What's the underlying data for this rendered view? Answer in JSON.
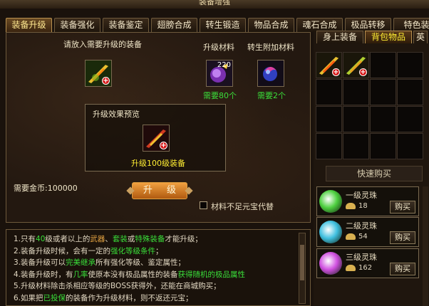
{
  "window": {
    "title": "装备增强"
  },
  "tabs": [
    "装备升级",
    "装备强化",
    "装备鉴定",
    "翅膀合成",
    "转生锻造",
    "物品合成",
    "魂石合成",
    "极品转移",
    "特色装"
  ],
  "main": {
    "equip_prompt": "请放入需要升级的装备",
    "material_title": "升级材料",
    "material_count": "220",
    "material_need": "需要80个",
    "extra_title": "转生附加材料",
    "extra_need": "需要2个",
    "preview_title": "升级效果预览",
    "preview_result": "升级100级装备",
    "gold_label": "需要金币:100000",
    "upgrade_button": "升 级",
    "ingot_checkbox": "材料不足元宝代替"
  },
  "tips": [
    {
      "num": "1.",
      "parts": [
        [
          "只有",
          ""
        ],
        [
          "40",
          "g"
        ],
        [
          "级或者以上的",
          ""
        ],
        [
          "武器",
          "o"
        ],
        [
          "、",
          ""
        ],
        [
          "套装",
          "g"
        ],
        [
          "或",
          ""
        ],
        [
          "特殊装备",
          "g"
        ],
        [
          "才能升级；",
          ""
        ]
      ]
    },
    {
      "num": "2.",
      "parts": [
        [
          "装备升级时候，会有一定的",
          ""
        ],
        [
          "强化等级条件",
          "g"
        ],
        [
          "；",
          ""
        ]
      ]
    },
    {
      "num": "3.",
      "parts": [
        [
          "装备升级可以",
          ""
        ],
        [
          "完美继承",
          "g"
        ],
        [
          "所有强化等级、鉴定属性；",
          ""
        ]
      ]
    },
    {
      "num": "4.",
      "parts": [
        [
          "装备升级时，有",
          ""
        ],
        [
          "几率",
          "g"
        ],
        [
          "使原本没有极品属性的装备",
          ""
        ],
        [
          "获得随机的极品属性",
          "g"
        ]
      ]
    },
    {
      "num": "5.",
      "parts": [
        [
          "升级材料除击杀相应等级的BOSS获得外，还能在商城购买；",
          ""
        ]
      ]
    },
    {
      "num": "6.",
      "parts": [
        [
          "如果把",
          ""
        ],
        [
          "已投保",
          "g"
        ],
        [
          "的装备作为升级材料，则不返还元宝；",
          ""
        ]
      ]
    }
  ],
  "right": {
    "tabs": [
      "身上装备",
      "背包物品",
      "英"
    ],
    "quick_buy": "快速购买",
    "shop": [
      {
        "name": "一级灵珠",
        "price": "18",
        "buy": "购买",
        "color": "#4ed040"
      },
      {
        "name": "二级灵珠",
        "price": "54",
        "buy": "购买",
        "color": "#40c0e0"
      },
      {
        "name": "三级灵珠",
        "price": "162",
        "buy": "购买",
        "color": "#d050e0"
      }
    ]
  }
}
